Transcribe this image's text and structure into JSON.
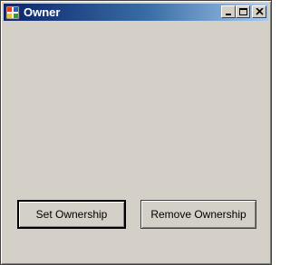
{
  "window": {
    "title": "Owner",
    "icon": "app-window-icon",
    "caption_buttons": [
      "minimize-icon",
      "maximize-icon",
      "close-icon"
    ]
  },
  "buttons": {
    "set_ownership": "Set Ownership",
    "remove_ownership": "Remove Ownership"
  },
  "colors": {
    "titlebar_start": "#0a246a",
    "titlebar_end": "#a6caf0",
    "face": "#d4d0c8"
  }
}
